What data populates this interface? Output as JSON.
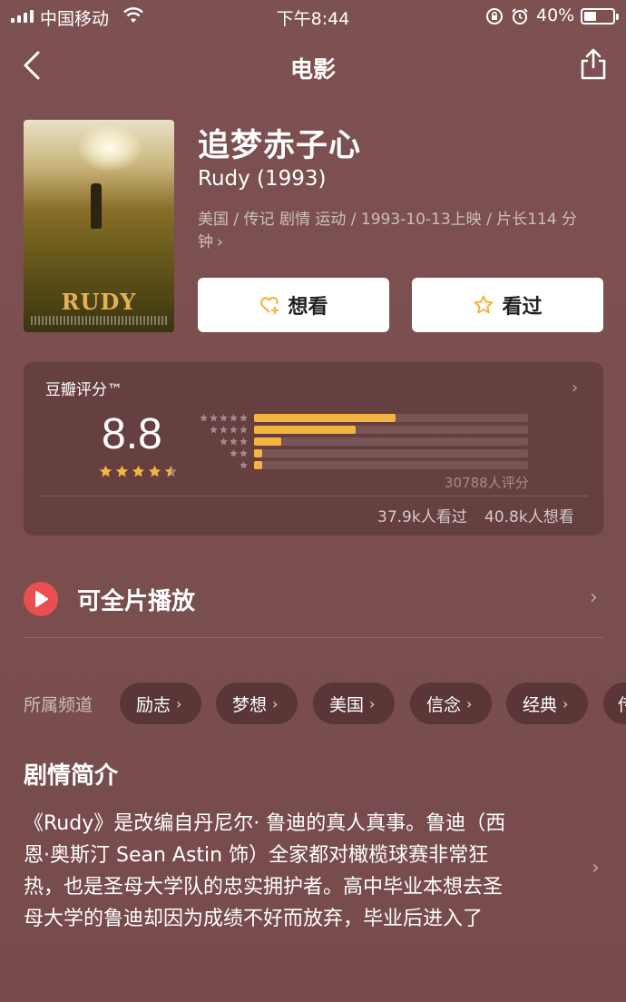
{
  "status_bar": {
    "carrier": "中国移动",
    "time": "下午8:44",
    "battery": "40%",
    "signal_bars": 4,
    "battery_level": 0.4
  },
  "nav": {
    "title": "电影",
    "back_icon": "chevron-left-icon",
    "share_icon": "share-icon"
  },
  "movie": {
    "poster_title": "RUDY",
    "title": "追梦赤子心",
    "subtitle": "Rudy (1993)",
    "meta_line1": "美国 / 传记 剧情 运动 / 1993-10-13上映 / 片长114 分",
    "meta_line2": "钟",
    "meta_chevron": "›"
  },
  "actions": {
    "want_label": "想看",
    "watched_label": "看过",
    "want_icon": "heart-plus-icon",
    "watched_icon": "star-outline-icon"
  },
  "rating": {
    "label": "豆瓣评分™",
    "score": "8.8",
    "star_value": 4.5,
    "distribution": [
      {
        "stars": 5,
        "fraction": 0.515
      },
      {
        "stars": 4,
        "fraction": 0.37
      },
      {
        "stars": 3,
        "fraction": 0.1
      },
      {
        "stars": 2,
        "fraction": 0.03
      },
      {
        "stars": 1,
        "fraction": 0.03
      }
    ],
    "count": "30788人评分",
    "watched": "37.9k人看过",
    "wish": "40.8k人想看",
    "accent": "#f5b440"
  },
  "playable": {
    "label": "可全片播放",
    "icon": "play-circle-icon",
    "icon_color": "#ea4f4f"
  },
  "channels": {
    "label": "所属频道",
    "items": [
      "励志",
      "梦想",
      "美国",
      "信念",
      "经典",
      "传"
    ]
  },
  "synopsis": {
    "title": "剧情简介",
    "lines": [
      "《Rudy》是改编自丹尼尔· 鲁迪的真人真事。鲁迪（西",
      "恩·奥斯汀 Sean Astin 饰）全家都对橄榄球赛非常狂",
      "热，也是圣母大学队的忠实拥护者。高中毕业本想去圣",
      "母大学的鲁迪却因为成绩不好而放弃，毕业后进入了"
    ]
  },
  "colors": {
    "background": "#7a4f4f",
    "card": "#5a3434",
    "button": "#ffffff"
  }
}
